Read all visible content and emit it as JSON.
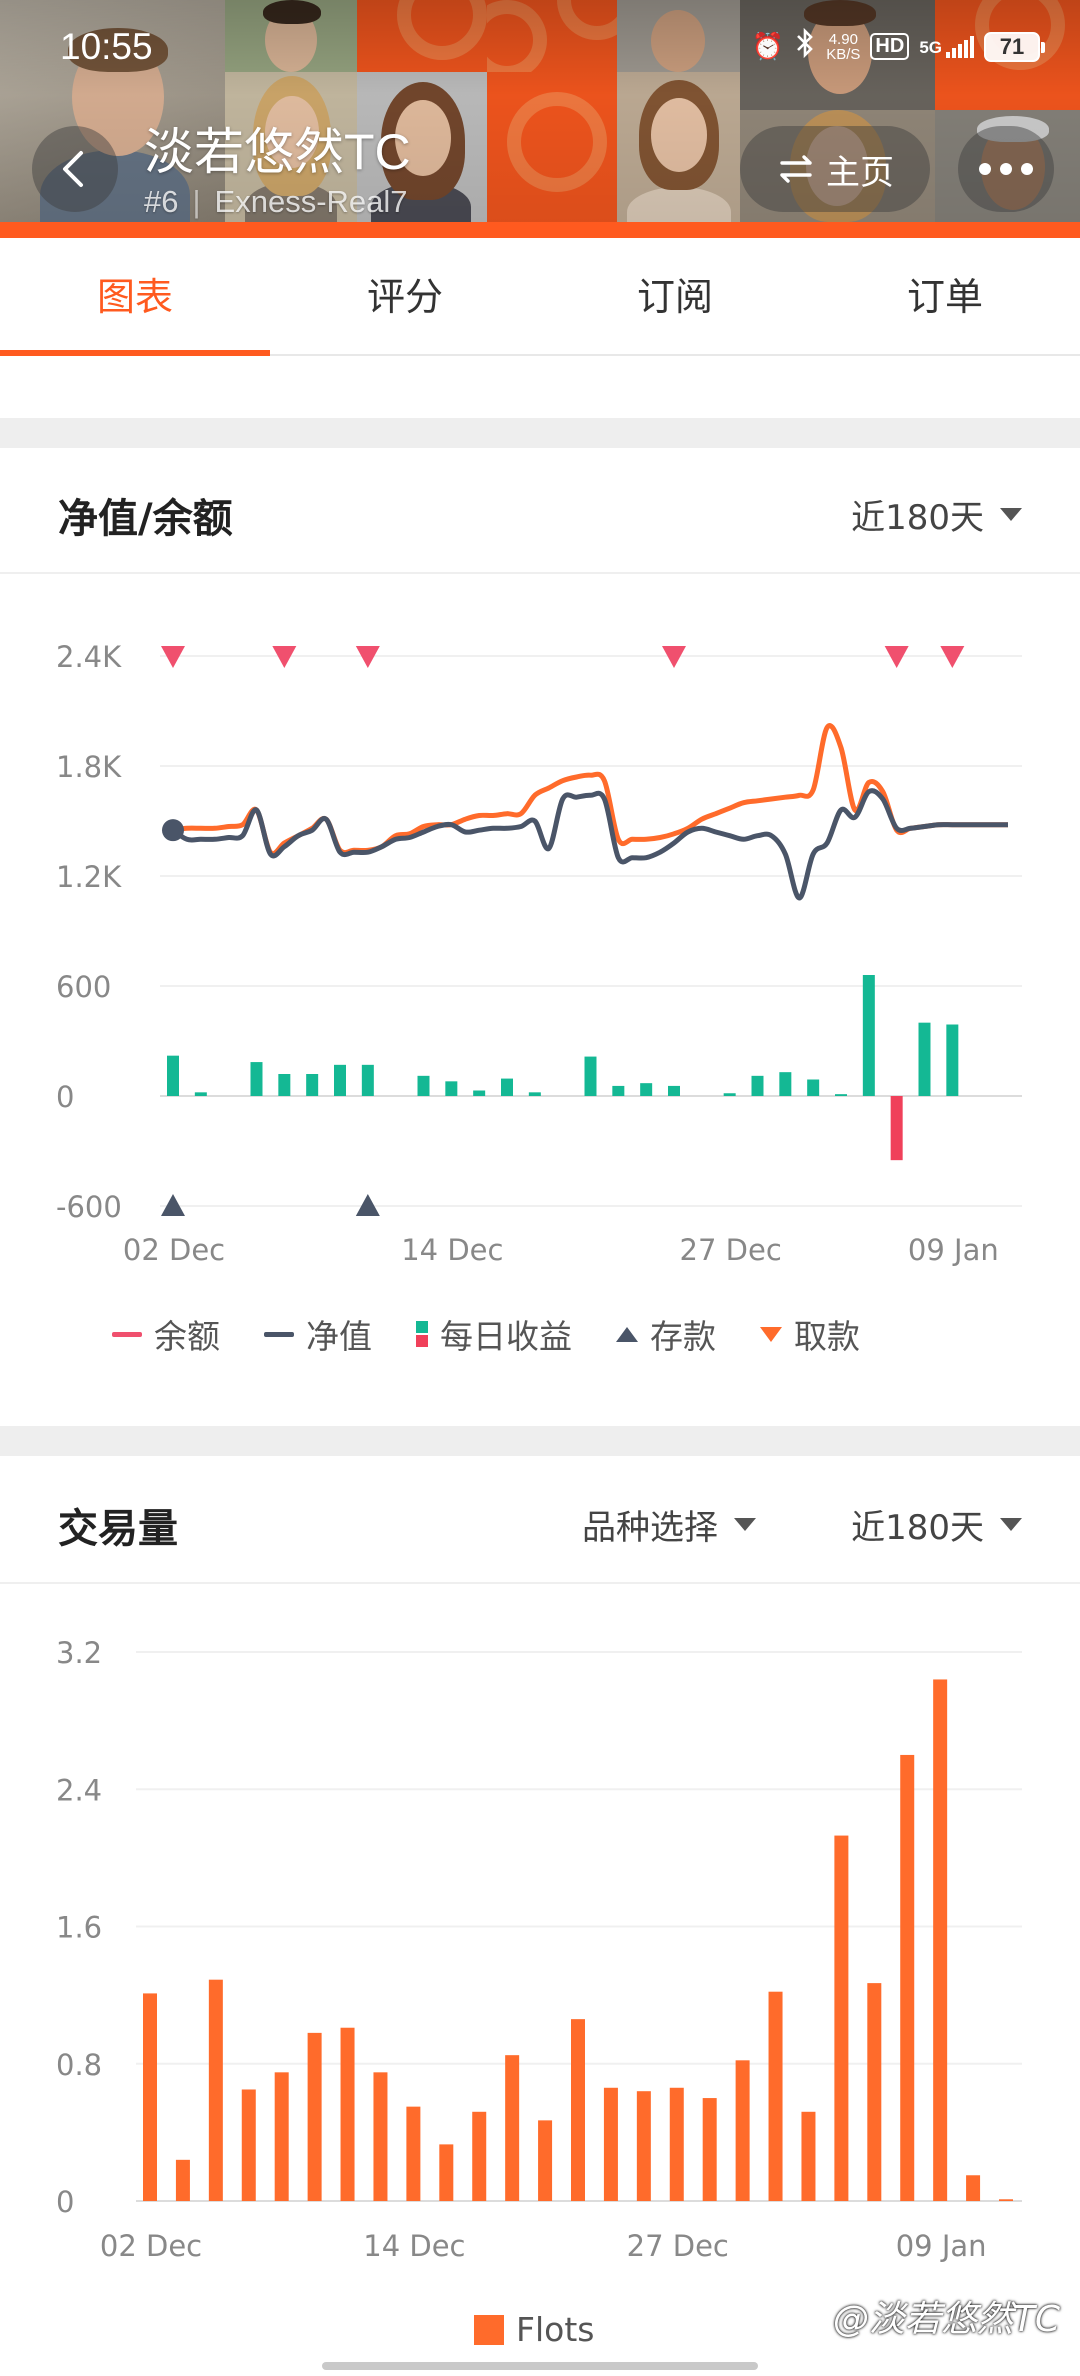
{
  "status_bar": {
    "time": "10:55",
    "net_speed_value": "4.90",
    "net_speed_unit": "KB/S",
    "hd": "HD",
    "network": "5G",
    "battery": "71"
  },
  "header": {
    "trader_name": "淡若悠然TC",
    "rank": "#6",
    "account": "Exness-Real7",
    "home_label": "主页",
    "accent": "#ff5a1f"
  },
  "tabs": [
    {
      "label": "图表",
      "active": true
    },
    {
      "label": "评分",
      "active": false
    },
    {
      "label": "订阅",
      "active": false
    },
    {
      "label": "订单",
      "active": false
    }
  ],
  "equity_card": {
    "title": "净值/余额",
    "range": "近180天",
    "legend": [
      "余额",
      "净值",
      "每日收益",
      "存款",
      "取款"
    ]
  },
  "volume_card": {
    "title": "交易量",
    "symbol_select": "品种选择",
    "range": "近180天",
    "legend": [
      "Flots"
    ]
  },
  "watermark": "@淡若悠然TC",
  "chart_data": [
    {
      "type": "line",
      "title": "净值/余额",
      "x_tick_labels": [
        "02 Dec",
        "14 Dec",
        "27 Dec",
        "09 Jan"
      ],
      "y_tick_labels": [
        "2.4K",
        "1.8K",
        "1.2K",
        "600",
        "0",
        "-600"
      ],
      "ylim": [
        -600,
        2400
      ],
      "x": [
        0,
        1,
        2,
        3,
        4,
        5,
        6,
        7,
        8,
        9,
        10,
        11,
        12,
        13,
        14,
        15,
        16,
        17,
        18,
        19,
        20,
        21,
        22,
        23,
        24,
        25,
        26,
        27,
        28,
        29,
        30,
        31,
        32,
        33,
        34,
        35,
        36,
        37,
        38,
        39,
        40,
        41,
        42,
        43,
        44,
        45,
        46,
        47,
        48,
        49,
        50,
        51,
        52,
        53,
        54,
        55,
        56,
        57,
        58,
        59,
        60
      ],
      "series": [
        {
          "name": "余额",
          "color": "#ff6b2b",
          "values": [
            1450,
            1460,
            1460,
            1460,
            1470,
            1480,
            1560,
            1330,
            1380,
            1420,
            1460,
            1510,
            1340,
            1340,
            1340,
            1360,
            1420,
            1430,
            1470,
            1480,
            1480,
            1510,
            1530,
            1530,
            1540,
            1540,
            1640,
            1680,
            1720,
            1740,
            1750,
            1720,
            1400,
            1400,
            1400,
            1410,
            1430,
            1460,
            1510,
            1540,
            1570,
            1600,
            1610,
            1620,
            1630,
            1640,
            1670,
            2010,
            1900,
            1560,
            1710,
            1660,
            1450,
            1460,
            1470,
            1480,
            1480,
            1480,
            1480,
            1480,
            1480
          ]
        },
        {
          "name": "净值",
          "color": "#4a5568",
          "values": [
            1450,
            1400,
            1400,
            1400,
            1410,
            1420,
            1560,
            1320,
            1360,
            1420,
            1450,
            1510,
            1330,
            1330,
            1330,
            1360,
            1400,
            1410,
            1440,
            1470,
            1480,
            1440,
            1450,
            1460,
            1460,
            1470,
            1500,
            1350,
            1620,
            1630,
            1640,
            1620,
            1300,
            1300,
            1300,
            1330,
            1380,
            1440,
            1460,
            1440,
            1420,
            1400,
            1420,
            1420,
            1320,
            1080,
            1320,
            1380,
            1560,
            1520,
            1660,
            1620,
            1460,
            1460,
            1470,
            1480,
            1480,
            1480,
            1480,
            1480,
            1480
          ]
        },
        {
          "name": "每日收益",
          "type": "bar",
          "colors": {
            "positive": "#14b894",
            "negative": "#f0405a"
          },
          "x": [
            0,
            2,
            6,
            8,
            10,
            12,
            14,
            18,
            20,
            22,
            24,
            26,
            30,
            32,
            34,
            36,
            40,
            42,
            44,
            46,
            48,
            50,
            52,
            54,
            56
          ],
          "values": [
            220,
            20,
            185,
            120,
            120,
            170,
            170,
            110,
            80,
            30,
            95,
            20,
            215,
            55,
            70,
            55,
            15,
            110,
            130,
            90,
            10,
            660,
            -350,
            400,
            390
          ]
        },
        {
          "name": "存款",
          "type": "markers",
          "color": "#4a5568",
          "x": [
            0,
            14
          ],
          "values": [
            -600,
            -600
          ]
        },
        {
          "name": "取款",
          "type": "markers",
          "color": "#f0506e",
          "x": [
            0,
            8,
            14,
            36,
            52,
            56
          ],
          "values": [
            2400,
            2400,
            2400,
            2400,
            2400,
            2400
          ]
        }
      ]
    },
    {
      "type": "bar",
      "title": "交易量",
      "x_tick_labels": [
        "02 Dec",
        "14 Dec",
        "27 Dec",
        "09 Jan"
      ],
      "y_tick_labels": [
        "3.2",
        "2.4",
        "1.6",
        "0.8",
        "0"
      ],
      "ylim": [
        0,
        3.2
      ],
      "series": [
        {
          "name": "Flots",
          "color": "#ff6b2b",
          "values": [
            1.21,
            0.24,
            1.29,
            0.65,
            0.75,
            0.98,
            1.01,
            0.75,
            0.55,
            0.33,
            0.52,
            0.85,
            0.47,
            1.06,
            0.66,
            0.64,
            0.66,
            0.6,
            0.82,
            1.22,
            0.52,
            2.13,
            1.27,
            2.6,
            3.04,
            0.15,
            0.01
          ]
        }
      ]
    }
  ]
}
